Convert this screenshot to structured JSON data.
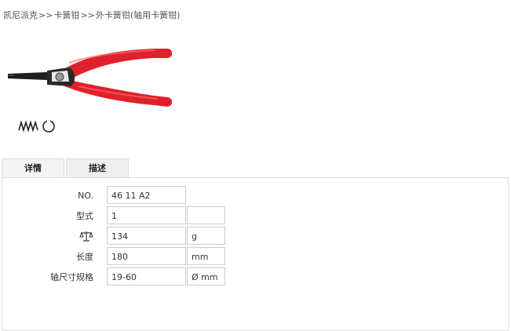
{
  "breadcrumb": {
    "items": [
      "凯尼派克",
      "卡簧钳",
      "外卡簧钳(轴用卡簧钳)"
    ],
    "separator": ">>"
  },
  "images": {
    "product_icon": "circlip-pliers-icon",
    "spring_icon": "spring-circlip-symbol-icon"
  },
  "tabs": [
    {
      "label": "详情",
      "active": true
    },
    {
      "label": "描述",
      "active": false
    }
  ],
  "specs": [
    {
      "label": "NO.",
      "value": "46 11 A2",
      "unit": null
    },
    {
      "label": "型式",
      "value": "1",
      "unit": ""
    },
    {
      "label": "",
      "icon": "weight-scale-icon",
      "value": "134",
      "unit": "g"
    },
    {
      "label": "长度",
      "value": "180",
      "unit": "mm"
    },
    {
      "label": "轴尺寸规格",
      "value": "19-60",
      "unit": "Ø mm"
    }
  ],
  "colors": {
    "handle_red": "#e0202a",
    "metal_dark": "#2a2a2a",
    "tab_bg": "#eeeeee",
    "border": "#cccccc"
  }
}
